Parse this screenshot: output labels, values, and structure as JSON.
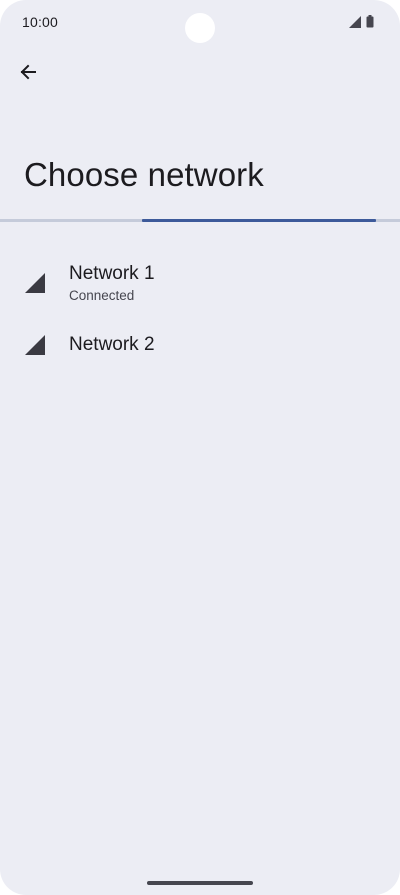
{
  "status_bar": {
    "time": "10:00",
    "icons": [
      "cell-signal-icon",
      "battery-icon"
    ]
  },
  "app_bar": {
    "back_icon": "arrow-back-icon"
  },
  "page": {
    "title": "Choose network"
  },
  "colors": {
    "background": "#ecedf4",
    "text_primary": "#1c1b1f",
    "text_secondary": "#46464f",
    "accent": "#3d5a9a",
    "track": "#c5cbda"
  },
  "networks": [
    {
      "name": "Network 1",
      "status": "Connected",
      "icon": "cell-signal-icon"
    },
    {
      "name": "Network 2",
      "status": "",
      "icon": "cell-signal-icon"
    }
  ]
}
